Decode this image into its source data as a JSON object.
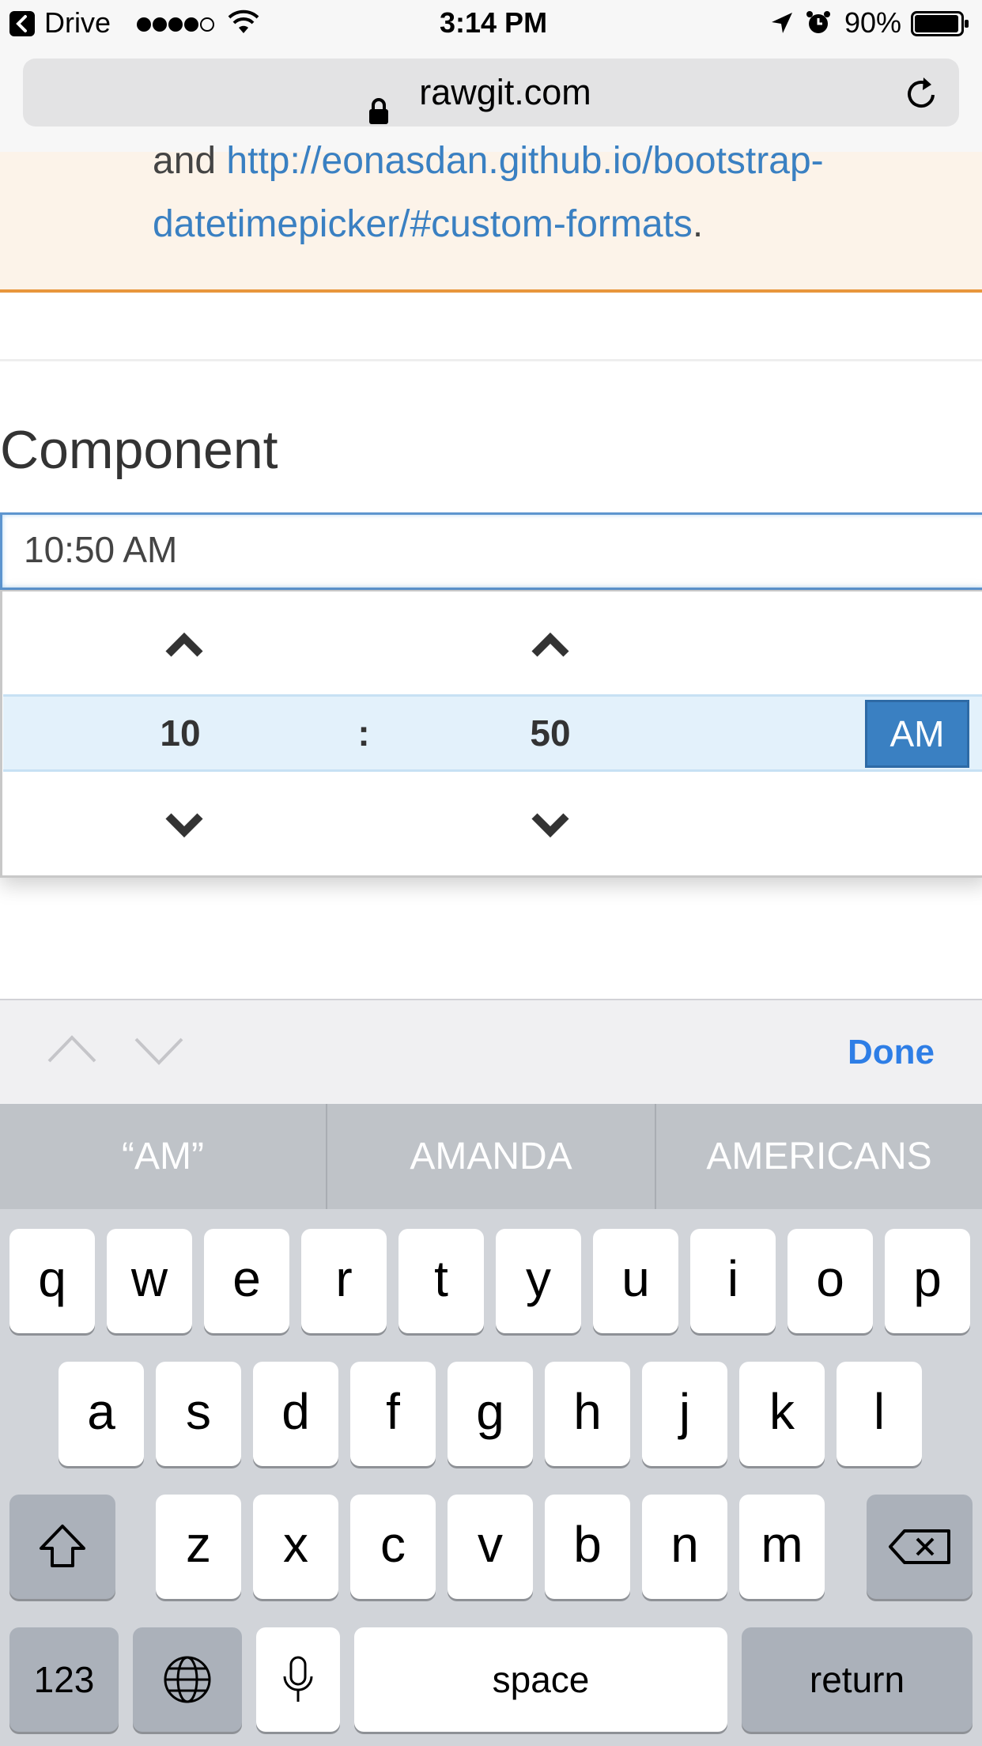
{
  "status_bar": {
    "back_app": "Drive",
    "time": "3:14 PM",
    "battery": "90%"
  },
  "url_bar": {
    "domain": "rawgit.com"
  },
  "alert": {
    "line1_prefix": "and ",
    "line1_link": "http://eonasdan.github.io/bootstrap-",
    "line2_link": "datetimepicker/#custom-formats",
    "line2_suffix": "."
  },
  "section": {
    "title": "Component"
  },
  "time_input": {
    "value": "10:50 AM"
  },
  "picker": {
    "hour": "10",
    "separator": ":",
    "minute": "50",
    "period": "AM"
  },
  "accessory": {
    "done_label": "Done"
  },
  "suggestions": [
    "“AM”",
    "AMANDA",
    "AMERICANS"
  ],
  "keyboard": {
    "row1": [
      "q",
      "w",
      "e",
      "r",
      "t",
      "y",
      "u",
      "i",
      "o",
      "p"
    ],
    "row2": [
      "a",
      "s",
      "d",
      "f",
      "g",
      "h",
      "j",
      "k",
      "l"
    ],
    "row3": [
      "z",
      "x",
      "c",
      "v",
      "b",
      "n",
      "m"
    ],
    "numbers_label": "123",
    "space_label": "space",
    "return_label": "return"
  }
}
